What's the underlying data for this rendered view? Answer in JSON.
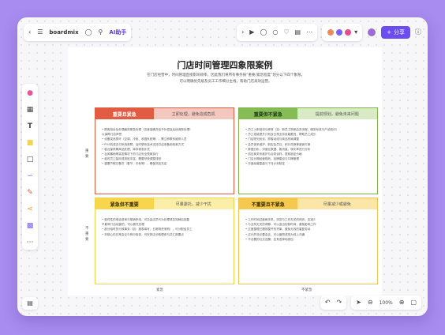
{
  "app": {
    "name": "boardmix",
    "ai_label": "AI助手",
    "share_label": "分享"
  },
  "zoom": "100%",
  "board": {
    "title": "门店时间管理四象限案例",
    "subtitle": [
      "在门店经营中，时间管理直接影响效率，因此我们将所有事务按“重要/紧急程度”划分以下四个象限，",
      "可以明确优先级及员工工作细分主线，帮助门店高效运营。"
    ],
    "axis": {
      "top": "重要",
      "bottom": "不重要",
      "left": "紧急",
      "right": "不紧急"
    },
    "quadrants": [
      {
        "tag": "重要且紧急",
        "desc": "立即处理，避免造成危机",
        "colors": {
          "border": "#e05a44",
          "tag_bg": "#e25b43",
          "tag_fg": "#ffffff",
          "desc_bg": "#f4c8bf"
        },
        "lines": [
          "•  顾客投诉及处理细则紧急处理（迅速准确并给予补偿及后续追踪处理）",
          "   以保障门店声誉",
          "•  设备突然损坏（空调、冷柜、收银系统等），需立即联系维修人员",
          "•  POS机或支付系统故障，及时联系技术支持并启用备用收款方式",
          "•  临近保质期商品处理、库存紧急补货",
          "•  台风暴雨等突发情况下的门店安全预案执行",
          "•  临时员工缺岗或排班冲突，需要尽快调整排班",
          "•  重要节假日备货（春节、中秋等），确保货品充足"
        ]
      },
      {
        "tag": "重要但不紧急",
        "desc": "提前规划，避免未来问题",
        "colors": {
          "border": "#7ab148",
          "tag_bg": "#86bc55",
          "tag_fg": "#1f3a10",
          "desc_bg": "#d8ebc4"
        },
        "lines": [
          "•  员工入职培训与考核（如：新员工熟悉店务流程、服务标准与产品知识）",
          "•  员工技能提升计划及日常业务技能跟进，帮助员工成长",
          "•  门店陈列优化，顾客动线与商品布局调整",
          "•  会员体系维护，制定会员日、积分兑换等营销方案",
          "•  数据分析，对营业数据、客流量、转化率进行分析",
          "•  供应商关系维护与合同谈判，提前锁定价格",
          "•  门店长期经营规划，品牌建设与口碑管理",
          "•  月度经营复盘与下月计划制定"
        ]
      },
      {
        "tag": "紧急但不重要",
        "desc": "尽量委托，减少干扰",
        "colors": {
          "border": "#f0d34a",
          "tag_bg": "#f7d64d",
          "tag_fg": "#3a2f00",
          "desc_bg": "#fbeea8"
        },
        "lines": [
          "•  临时性的电话咨询与推销来电，可交由店员代为处理或告知稍后回复",
          "   不影响门店经营的，可以委托处理",
          "•  部分临时的行政事务（如：报表填写、日常物资采购），可分配给员工",
          "•  非核心的日常会议与例行检查，可安排店长助理参与并汇报要点"
        ]
      },
      {
        "tag": "不重要且不紧急",
        "desc": "尽量减少或避免",
        "colors": {
          "border": "#f0c14e",
          "tag_bg": "#f5c94f",
          "tag_fg": "#3a2f00",
          "desc_bg": "#fbe6a8"
        },
        "lines": [
          "•  工作时间过度刷手机、浏览与工作无关的网页，应减少",
          "•  与业务无关的闲聊，可以适当控制时间，避免影响工作",
          "•  过度整理已摆放整齐的货架，避免无效的重复劳动",
          "•  过长的非必要会议，可以缩短或改为线上沟通",
          "•  不必要的社交应酬，应有选择地参加"
        ]
      }
    ]
  }
}
